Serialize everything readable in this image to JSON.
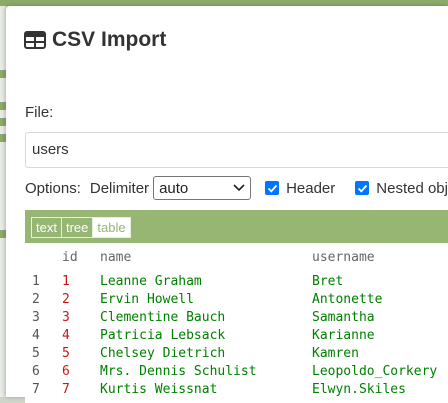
{
  "dialog": {
    "title": "CSV Import",
    "file_label": "File:",
    "file_value": "users",
    "options": {
      "label": "Options:",
      "delimiter_label": "Delimiter",
      "delimiter_value": "auto",
      "header_label": "Header",
      "header_checked": true,
      "nested_label": "Nested obje",
      "nested_checked": true
    }
  },
  "preview": {
    "modes": [
      "text",
      "tree",
      "table"
    ],
    "active_mode": "table",
    "columns": [
      "id",
      "name",
      "username"
    ],
    "rows": [
      {
        "index": "1",
        "id": "1",
        "name": "Leanne Graham",
        "username": "Bret"
      },
      {
        "index": "2",
        "id": "2",
        "name": "Ervin Howell",
        "username": "Antonette"
      },
      {
        "index": "3",
        "id": "3",
        "name": "Clementine Bauch",
        "username": "Samantha"
      },
      {
        "index": "4",
        "id": "4",
        "name": "Patricia Lebsack",
        "username": "Karianne"
      },
      {
        "index": "5",
        "id": "5",
        "name": "Chelsey Dietrich",
        "username": "Kamren"
      },
      {
        "index": "6",
        "id": "6",
        "name": "Mrs. Dennis Schulist",
        "username": "Leopoldo_Corkery"
      },
      {
        "index": "7",
        "id": "7",
        "name": "Kurtis Weissnat",
        "username": "Elwyn.Skiles"
      }
    ]
  },
  "colors": {
    "accent": "#97b674",
    "checkbox": "#0075ff",
    "number": "#c41a16",
    "string": "#008000"
  },
  "icons": {
    "title": "table-icon",
    "select": "chevron-down-icon",
    "checkbox": "checkmark-icon"
  }
}
